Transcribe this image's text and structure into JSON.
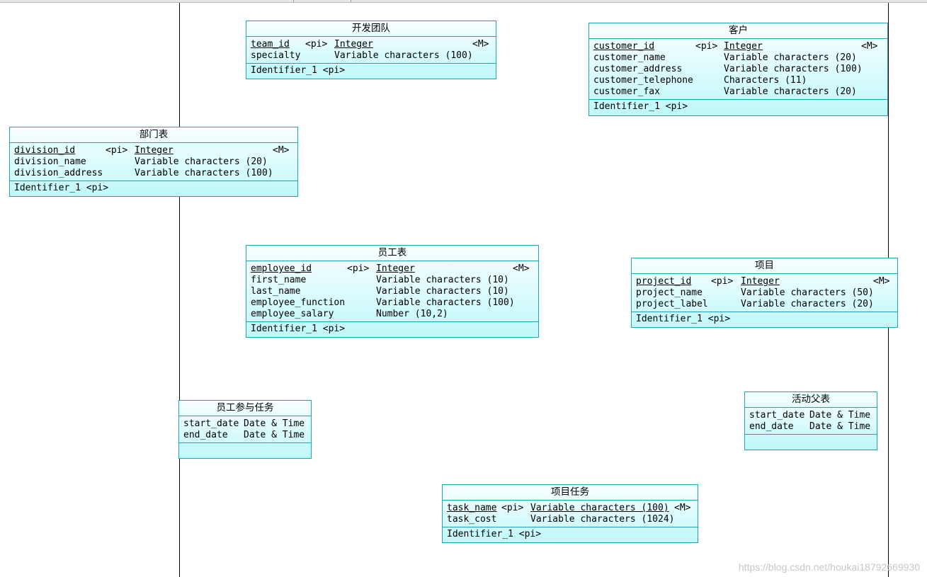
{
  "entities": {
    "team": {
      "title": "开发团队",
      "attrs": [
        {
          "name": "team_id",
          "key": "<pi>",
          "type": "Integer",
          "mandatory": "<M>"
        },
        {
          "name": "specialty",
          "key": "",
          "type": "Variable characters (100)",
          "mandatory": ""
        }
      ],
      "identifier": "Identifier_1 <pi>"
    },
    "customer": {
      "title": "客户",
      "attrs": [
        {
          "name": "customer_id",
          "key": "<pi>",
          "type": "Integer",
          "mandatory": "<M>"
        },
        {
          "name": "customer_name",
          "key": "",
          "type": "Variable characters (20)",
          "mandatory": ""
        },
        {
          "name": "customer_address",
          "key": "",
          "type": "Variable characters (100)",
          "mandatory": ""
        },
        {
          "name": "customer_telephone",
          "key": "",
          "type": "Characters (11)",
          "mandatory": ""
        },
        {
          "name": "customer_fax",
          "key": "",
          "type": "Variable characters (20)",
          "mandatory": ""
        }
      ],
      "identifier": "Identifier_1 <pi>"
    },
    "division": {
      "title": "部门表",
      "attrs": [
        {
          "name": "division_id",
          "key": "<pi>",
          "type": "Integer",
          "mandatory": "<M>"
        },
        {
          "name": "division_name",
          "key": "",
          "type": "Variable characters (20)",
          "mandatory": ""
        },
        {
          "name": "division_address",
          "key": "",
          "type": "Variable characters (100)",
          "mandatory": ""
        }
      ],
      "identifier": "Identifier_1 <pi>"
    },
    "employee": {
      "title": "员工表",
      "attrs": [
        {
          "name": "employee_id",
          "key": "<pi>",
          "type": "Integer",
          "mandatory": "<M>"
        },
        {
          "name": "first_name",
          "key": "",
          "type": "Variable characters (10)",
          "mandatory": ""
        },
        {
          "name": "last_name",
          "key": "",
          "type": "Variable characters (10)",
          "mandatory": ""
        },
        {
          "name": "employee_function",
          "key": "",
          "type": "Variable characters (100)",
          "mandatory": ""
        },
        {
          "name": "employee_salary",
          "key": "",
          "type": "Number (10,2)",
          "mandatory": ""
        }
      ],
      "identifier": "Identifier_1 <pi>"
    },
    "project": {
      "title": "项目",
      "attrs": [
        {
          "name": "project_id",
          "key": "<pi>",
          "type": "Integer",
          "mandatory": "<M>"
        },
        {
          "name": "project_name",
          "key": "",
          "type": "Variable characters (50)",
          "mandatory": ""
        },
        {
          "name": "project_label",
          "key": "",
          "type": "Variable characters (20)",
          "mandatory": ""
        }
      ],
      "identifier": "Identifier_1 <pi>"
    },
    "participation": {
      "title": "员工参与任务",
      "attrs": [
        {
          "name": "start_date",
          "key": "",
          "type": "Date & Time",
          "mandatory": ""
        },
        {
          "name": "end_date",
          "key": "",
          "type": "Date & Time",
          "mandatory": ""
        }
      ],
      "identifier": ""
    },
    "activity": {
      "title": "活动父表",
      "attrs": [
        {
          "name": "start_date",
          "key": "",
          "type": "Date & Time",
          "mandatory": ""
        },
        {
          "name": "end_date",
          "key": "",
          "type": "Date & Time",
          "mandatory": ""
        }
      ],
      "identifier": ""
    },
    "task": {
      "title": "项目任务",
      "attrs": [
        {
          "name": "task_name",
          "key": "<pi>",
          "type": "Variable characters (100)",
          "mandatory": "<M>"
        },
        {
          "name": "task_cost",
          "key": "",
          "type": "Variable characters (1024)",
          "mandatory": ""
        }
      ],
      "identifier": "Identifier_1 <pi>"
    }
  },
  "watermark": "https://blog.csdn.net/houkai18792669930"
}
